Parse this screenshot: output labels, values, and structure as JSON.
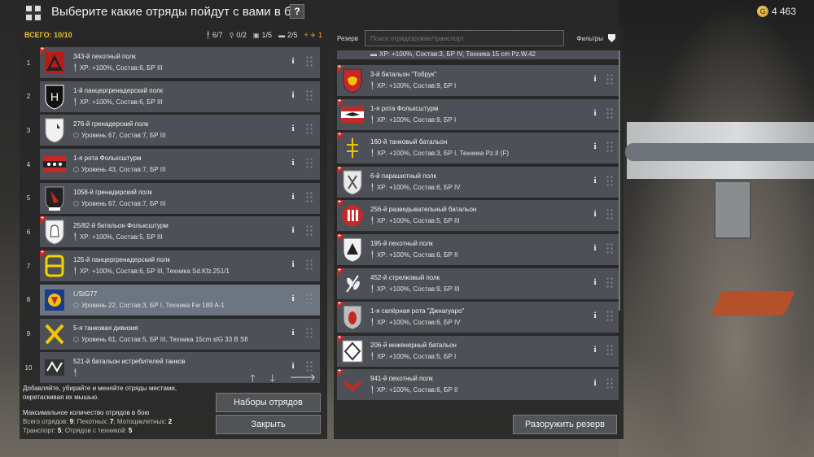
{
  "header": {
    "title": "Выберите какие отряды пойдут с вами в бой",
    "help_label": "?",
    "currency": "4 463",
    "coin_symbol": "G"
  },
  "lineup": {
    "total_label": "ВСЕГО: 10/10",
    "counts": {
      "infantry": "6/7",
      "motorcycle": "0/2",
      "transport": "1/5",
      "vehicles": "2/5",
      "plus": "+",
      "aircraft": "1"
    },
    "rows": [
      {
        "num": "1",
        "name": "343-й пехотный полк",
        "stats": "XP: +100%, Состав:6, БР III",
        "emblem": "triangle",
        "new": true
      },
      {
        "num": "2",
        "name": "1-й панцергренадерский  полк",
        "stats": "XP: +100%, Состав:6, БР III",
        "emblem": "shield-h",
        "new": false
      },
      {
        "num": "3",
        "name": "276-й гренадерский полк",
        "stats": "Уровень 67, Состав:7, БР III",
        "emblem": "shield-white",
        "new": false
      },
      {
        "num": "4",
        "name": "1-я рота Фольксштурм",
        "stats": "Уровень 43, Состав:7, БР III",
        "emblem": "flag-stars",
        "new": false
      },
      {
        "num": "5",
        "name": "1058-й гренадерский полк",
        "stats": "Уровень 67, Состав:7, БР III",
        "emblem": "shield-red",
        "new": false
      },
      {
        "num": "6",
        "name": "25/82-й батальон Фольксштурм",
        "stats": "XP: +100%, Состав:5, БР III",
        "emblem": "bell",
        "new": true
      },
      {
        "num": "7",
        "name": "125-й панцергренадерский полк",
        "stats": "XP: +100%, Состав:6, БР III,  Техника Sd.Kfz.251/1",
        "emblem": "b-letter",
        "new": true
      },
      {
        "num": "8",
        "name": "I./StG77",
        "stats": "Уровень 22, Состав:3, БР I,  Техника Fw 189 A-1",
        "emblem": "shield-blue",
        "new": false
      },
      {
        "num": "9",
        "name": "5-я танковая дивизия",
        "stats": "Уровень 61, Состав:5, БР III,  Техника 15cm sIG 33 B Sfl",
        "emblem": "x-cross",
        "new": false
      },
      {
        "num": "10",
        "name": "521-й батальон истребителей танков",
        "stats": "",
        "emblem": "wolf",
        "new": false
      }
    ],
    "hint": "Добавляйте, убирайте и меняйте отряды местами, перетаскивая их мышью.",
    "max_title": "Максимальное количество отрядов в бою",
    "max_total_label": "Всего отрядов: ",
    "max_total": "9",
    "max_inf_label": "; Пехотных: ",
    "max_inf": "7",
    "max_moto_label": "; Мотоциклетных: ",
    "max_moto": "2",
    "max_trans_label": "Транспорт: ",
    "max_trans": "5",
    "max_tech_label": "; Отрядов с техникой: ",
    "max_tech": "5",
    "presets_button": "Наборы отрядов",
    "close_button": "Закрыть"
  },
  "reserve": {
    "label": "Резерв",
    "search_placeholder": "Поиск отряд/оружие/транспорт",
    "filters_label": "Фильтры",
    "partial_stats": "XP: +100%, Состав:3, БР IV,  Техника 15 cm Pz.W.42",
    "rows": [
      {
        "name": "3-й батальон \"Тобрук\"",
        "stats": "XP: +100%, Состав:9, БР I",
        "emblem": "lion"
      },
      {
        "name": "1-я рота Фольксштурм",
        "stats": "XP: +100%, Состав:9, БР I",
        "emblem": "eagle-flag"
      },
      {
        "name": "160-й танковый батальон",
        "stats": "XP: +100%, Состав:3, БР I,  Техника Pz.II (F)",
        "emblem": "yellow-cross"
      },
      {
        "name": "6-й парашютный полк",
        "stats": "XP: +100%, Состав:6, БР IV",
        "emblem": "shield-grey"
      },
      {
        "name": "256-й разведывательный батальон",
        "stats": "XP: +100%, Состав:5, БР III",
        "emblem": "red-circle"
      },
      {
        "name": "195-й пехотный полк",
        "stats": "XP: +100%, Состав:6, БР II",
        "emblem": "shield-tri"
      },
      {
        "name": "452-й стрелковый полк",
        "stats": "XP: +100%, Состав:9, БР III",
        "emblem": "leaves"
      },
      {
        "name": "1-я сапёрная рота \"Джнагуаро\"",
        "stats": "XP: +100%, Состав:6, БР IV",
        "emblem": "grenade"
      },
      {
        "name": "206-й инженерный батальон",
        "stats": "XP: +100%, Состав:5, БР I",
        "emblem": "diamond"
      },
      {
        "name": "941-й пехотный полк",
        "stats": "XP: +100%, Состав:6, БР II",
        "emblem": "red-eagle"
      }
    ],
    "disarm_button": "Разоружить резерв"
  }
}
